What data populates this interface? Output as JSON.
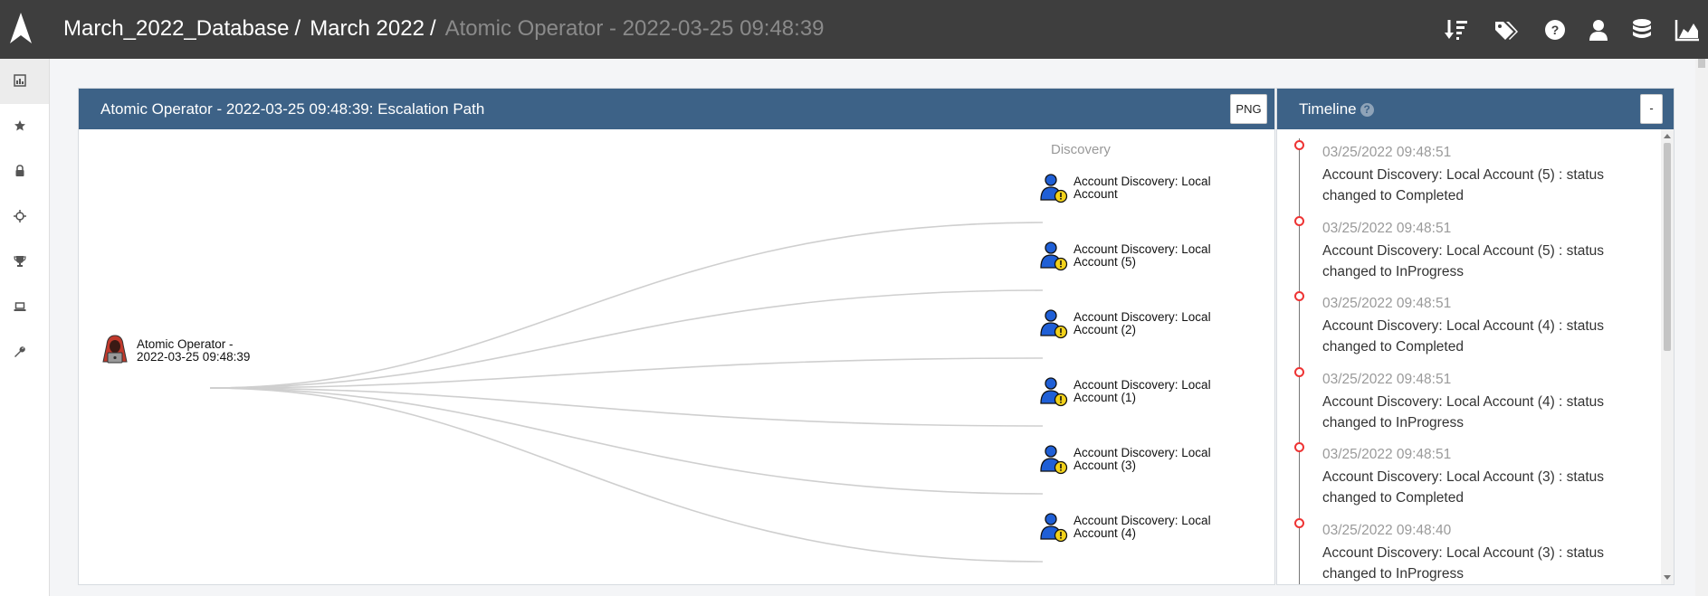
{
  "topbar": {
    "breadcrumbs": [
      "March_2022_Database",
      "March 2022",
      "Atomic Operator - 2022-03-25 09:48:39"
    ],
    "separator": "/",
    "icons": [
      "sort-icon",
      "tags-icon",
      "help-icon",
      "user-icon",
      "database-icon",
      "area-chart-icon"
    ]
  },
  "sidebar": {
    "items": [
      "dashboard-icon",
      "star-icon",
      "lock-icon",
      "crosshair-icon",
      "trophy-icon",
      "laptop-icon",
      "wrench-icon"
    ]
  },
  "graph_panel": {
    "title": "Atomic Operator - 2022-03-25 09:48:39: Escalation Path",
    "png_label": "PNG",
    "column_label": "Discovery",
    "root": {
      "line1": "Atomic Operator -",
      "line2": "2022-03-25 09:48:39",
      "icon": "hacker-icon"
    },
    "nodes": [
      {
        "line1": "Account Discovery: Local",
        "line2": "Account",
        "icon": "user-warning-icon"
      },
      {
        "line1": "Account Discovery: Local",
        "line2": "Account (5)",
        "icon": "user-warning-icon"
      },
      {
        "line1": "Account Discovery: Local",
        "line2": "Account (2)",
        "icon": "user-warning-icon"
      },
      {
        "line1": "Account Discovery: Local",
        "line2": "Account (1)",
        "icon": "user-warning-icon"
      },
      {
        "line1": "Account Discovery: Local",
        "line2": "Account (3)",
        "icon": "user-warning-icon"
      },
      {
        "line1": "Account Discovery: Local",
        "line2": "Account (4)",
        "icon": "user-warning-icon"
      }
    ]
  },
  "timeline": {
    "title": "Timeline",
    "help": "?",
    "collapse_label": "-",
    "items": [
      {
        "time": "03/25/2022 09:48:51",
        "text": "Account Discovery: Local Account (5) : status changed to Completed"
      },
      {
        "time": "03/25/2022 09:48:51",
        "text": "Account Discovery: Local Account (5) : status changed to InProgress"
      },
      {
        "time": "03/25/2022 09:48:51",
        "text": "Account Discovery: Local Account (4) : status changed to Completed"
      },
      {
        "time": "03/25/2022 09:48:51",
        "text": "Account Discovery: Local Account (4) : status changed to InProgress"
      },
      {
        "time": "03/25/2022 09:48:51",
        "text": "Account Discovery: Local Account (3) : status changed to Completed"
      },
      {
        "time": "03/25/2022 09:48:40",
        "text": "Account Discovery: Local Account (3) : status changed to InProgress"
      }
    ]
  },
  "colors": {
    "topbar": "#3e3e3e",
    "panel_header": "#3d6287",
    "timeline_dot": "#e33333",
    "user_icon": "#1f5fd6",
    "warning_badge": "#f2d21b",
    "hacker_icon": "#c0392b"
  }
}
